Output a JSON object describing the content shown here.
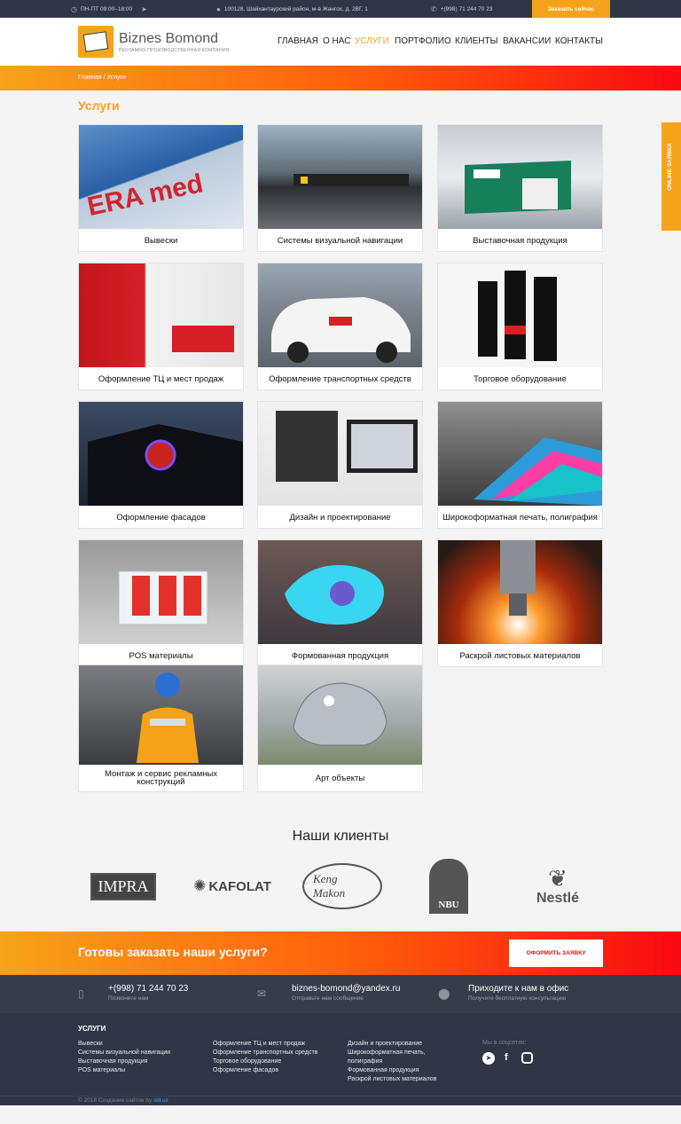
{
  "topbar": {
    "hours": "ПН-ПТ 09:00–18:00",
    "address": "100128, Шайхантаурский район, м-в Жангох, д. 2ВГ, 1",
    "phone": "+(998) 71 244 70 23",
    "order_button": "Заказать сейчас"
  },
  "brand": {
    "name": "Biznes Bomond",
    "tagline": "РЕКЛАМНО-ПРОИЗВОДСТВЕННАЯ КОМПАНИЯ"
  },
  "nav": [
    "ГЛАВНАЯ",
    "О НАС",
    "УСЛУГИ",
    "ПОРТФОЛИО",
    "КЛИЕНТЫ",
    "ВАКАНСИИ",
    "КОНТАКТЫ"
  ],
  "breadcrumb": "Главная / Услуги",
  "page_title": "Услуги",
  "side_tab": "ONLINE-ЗАЯВКА",
  "services": [
    "Вывески",
    "Системы визуальной навигации",
    "Выставочная продукция",
    "Оформление ТЦ и мест продаж",
    "Оформление транспортных средств",
    "Торговое оборудование",
    "Оформление фасадов",
    "Дизайн и проектирование",
    "Широкоформатная печать, полиграфия",
    "POS материалы",
    "Формованная продукция",
    "Раскрой листовых материалов",
    "Монтаж и сервис рекламных конструкций",
    "Арт объекты"
  ],
  "clients_title": "Наши клиенты",
  "clients": [
    "IMPRA",
    "KAFOLAT",
    "Keng Makon",
    "NBU",
    "Nestlé"
  ],
  "cta": {
    "text": "Готовы заказать наши услуги?",
    "button": "ОФОРМИТЬ ЗАЯВКУ"
  },
  "contacts": [
    {
      "main": "+(998) 71 244 70 23",
      "sub": "Позвоните нам"
    },
    {
      "main": "biznes-bomond@yandex.ru",
      "sub": "Отправьте нам сообщение"
    },
    {
      "main": "Приходите к нам в офис",
      "sub": "Получите бесплатную консультацию"
    }
  ],
  "footer": {
    "title": "УСЛУГИ",
    "col1": [
      "Вывески",
      "Системы визуальной навигации",
      "Выставочная продукция",
      "POS материалы"
    ],
    "col2": [
      "Оформление ТЦ и мест продаж",
      "Оформление транспортных средств",
      "Торговое оборудование",
      "Оформление фасадов"
    ],
    "col3": [
      "Дизайн и проектирование",
      "Широкоформатная печать,",
      "полиграфия",
      "Формованная продукция",
      "Раскрой листовых материалов"
    ],
    "social_label": "Мы в соцсетях:",
    "copyright": "© 2018 Создание сайтов by",
    "copyright_link": "sld.uz"
  },
  "colors": {
    "accent": "#f7a21b",
    "gradient_end": "#f80a12",
    "dark": "#2f3645"
  }
}
